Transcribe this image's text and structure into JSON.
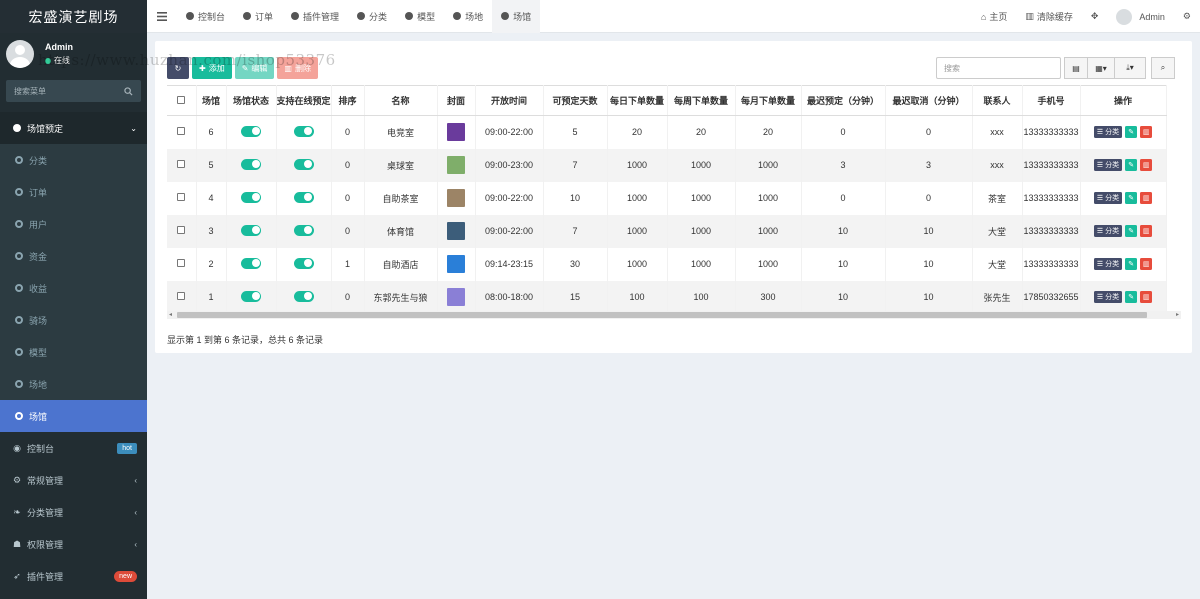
{
  "app": {
    "title": "宏盛演艺剧场"
  },
  "user": {
    "name": "Admin",
    "status": "在线"
  },
  "sidebar": {
    "search_placeholder": "搜索菜单",
    "group_label": "场馆预定",
    "sub_items": [
      "分类",
      "订单",
      "用户",
      "资金",
      "收益",
      "骑场",
      "模型",
      "场地",
      "场馆"
    ],
    "active_sub": "场馆",
    "main_items": [
      {
        "label": "控制台",
        "badge": "hot",
        "icon": "dashboard-icon"
      },
      {
        "label": "常规管理",
        "badge": "",
        "icon": "gears-icon"
      },
      {
        "label": "分类管理",
        "badge": "",
        "icon": "leaf-icon"
      },
      {
        "label": "权限管理",
        "badge": "",
        "icon": "group-icon"
      },
      {
        "label": "插件管理",
        "badge": "new",
        "icon": "rocket-icon"
      }
    ]
  },
  "topbar": {
    "tabs": [
      "控制台",
      "订单",
      "插件管理",
      "分类",
      "模型",
      "场地",
      "场馆"
    ],
    "active_tab": "场馆",
    "home": "主页",
    "clear_cache": "清除缓存",
    "user": "Admin"
  },
  "toolbar": {
    "add": "添加",
    "edit": "编辑",
    "delete": "删除",
    "search_placeholder": "搜索"
  },
  "watermark": "https://www.huzhan.com/ishop53376",
  "table": {
    "headers": [
      "场馆",
      "场馆状态",
      "支持在线预定",
      "排序",
      "名称",
      "封面",
      "开放时间",
      "可预定天数",
      "每日下单数量",
      "每周下单数量",
      "每月下单数量",
      "最迟预定（分钟）",
      "最迟取消（分钟）",
      "联系人",
      "手机号",
      "操作"
    ],
    "rows": [
      {
        "id": "6",
        "sort": "0",
        "name": "电竞室",
        "cover": "#6a3b9c",
        "hours": "09:00-22:00",
        "days": "5",
        "daily": "20",
        "weekly": "20",
        "monthly": "20",
        "late_book": "0",
        "late_cancel": "0",
        "contact": "xxx",
        "phone": "13333333333"
      },
      {
        "id": "5",
        "sort": "0",
        "name": "桌球室",
        "cover": "#7fae6a",
        "hours": "09:00-23:00",
        "days": "7",
        "daily": "1000",
        "weekly": "1000",
        "monthly": "1000",
        "late_book": "3",
        "late_cancel": "3",
        "contact": "xxx",
        "phone": "13333333333"
      },
      {
        "id": "4",
        "sort": "0",
        "name": "自助茶室",
        "cover": "#9c8466",
        "hours": "09:00-22:00",
        "days": "10",
        "daily": "1000",
        "weekly": "1000",
        "monthly": "1000",
        "late_book": "0",
        "late_cancel": "0",
        "contact": "茶室",
        "phone": "13333333333"
      },
      {
        "id": "3",
        "sort": "0",
        "name": "体育馆",
        "cover": "#3c5d7a",
        "hours": "09:00-22:00",
        "days": "7",
        "daily": "1000",
        "weekly": "1000",
        "monthly": "1000",
        "late_book": "10",
        "late_cancel": "10",
        "contact": "大堂",
        "phone": "13333333333"
      },
      {
        "id": "2",
        "sort": "1",
        "name": "自助酒店",
        "cover": "#2a7fd8",
        "hours": "09:14-23:15",
        "days": "30",
        "daily": "1000",
        "weekly": "1000",
        "monthly": "1000",
        "late_book": "10",
        "late_cancel": "10",
        "contact": "大堂",
        "phone": "13333333333"
      },
      {
        "id": "1",
        "sort": "0",
        "name": "东郭先生与狼",
        "cover": "#8a7fd6",
        "hours": "08:00-18:00",
        "days": "15",
        "daily": "100",
        "weekly": "100",
        "monthly": "300",
        "late_book": "10",
        "late_cancel": "10",
        "contact": "张先生",
        "phone": "17850332655"
      }
    ],
    "op_category": "分类"
  },
  "pager": {
    "summary": "显示第 1 到第 6 条记录，总共 6 条记录"
  }
}
